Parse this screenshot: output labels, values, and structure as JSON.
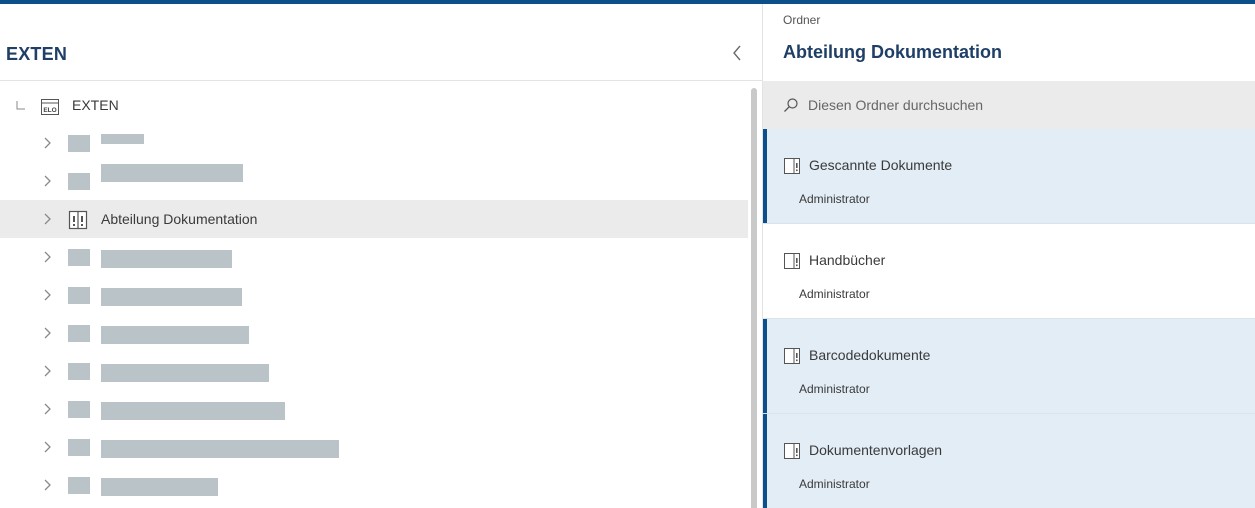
{
  "left_panel": {
    "title": "EXTEN",
    "tree": {
      "root": {
        "label": "EXTEN",
        "icon": "elo-archive-icon"
      },
      "selected": {
        "label": "Abteilung Dokumentation",
        "icon": "folder-register-icon"
      }
    }
  },
  "right_panel": {
    "caption": "Ordner",
    "title": "Abteilung Dokumentation",
    "search_placeholder": "Diesen Ordner durchsuchen",
    "items": [
      {
        "title": "Gescannte Dokumente",
        "subtitle": "Administrator",
        "marked": true
      },
      {
        "title": "Handbücher",
        "subtitle": "Administrator",
        "marked": false
      },
      {
        "title": "Barcodedokumente",
        "subtitle": "Administrator",
        "marked": true
      },
      {
        "title": "Dokumentenvorlagen",
        "subtitle": "Administrator",
        "marked": true
      }
    ]
  },
  "colors": {
    "accent": "#0d4f8b",
    "title_text": "#1f3f66",
    "marked_bg": "#e3edf5",
    "redaction": "#bac3c7",
    "selected_row": "#ebebeb"
  }
}
